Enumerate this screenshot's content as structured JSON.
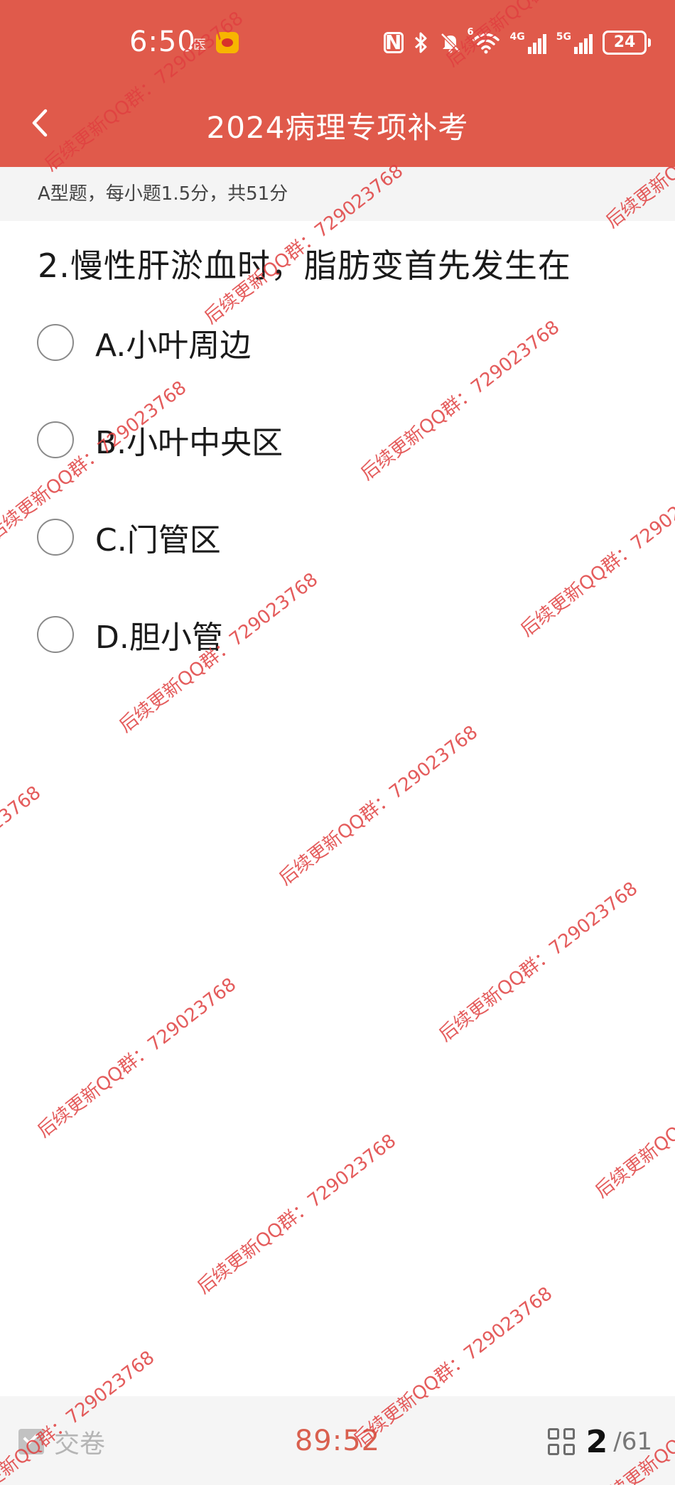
{
  "status_bar": {
    "time": "6:50",
    "app_badge": "医",
    "battery": "24",
    "network_1": "4G",
    "network_2": "5G",
    "wifi_badge": "6"
  },
  "header": {
    "title": "2024病理专项补考"
  },
  "section": {
    "info": "A型题，每小题1.5分，共51分"
  },
  "question": {
    "text": "2.慢性肝淤血时，脂肪变首先发生在",
    "options": [
      {
        "label": "A.小叶周边"
      },
      {
        "label": "B.小叶中央区"
      },
      {
        "label": "C.门管区"
      },
      {
        "label": "D.胆小管"
      }
    ]
  },
  "watermark": {
    "text": "后续更新QQ群：729023768"
  },
  "footer": {
    "submit_label": "交卷",
    "timer": "89:52",
    "current": "2",
    "total": "/61"
  },
  "colors": {
    "brand": "#e05a4b",
    "timer": "#d9604f",
    "watermark": "#e04040"
  }
}
